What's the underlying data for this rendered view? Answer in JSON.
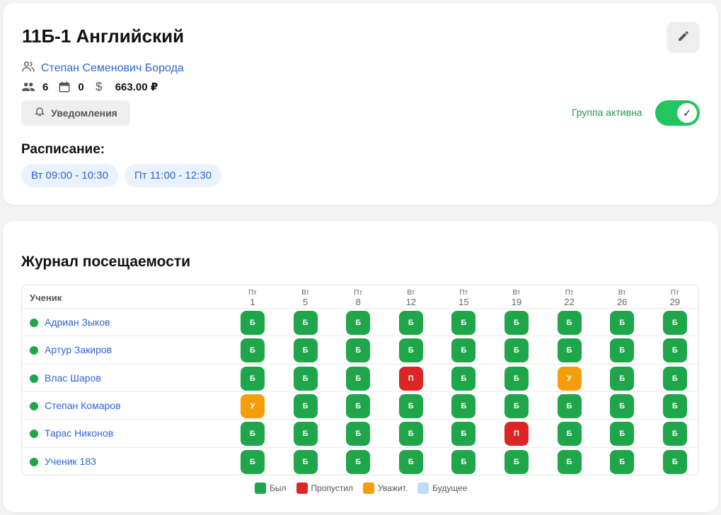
{
  "group": {
    "title": "11Б-1 Английский",
    "teacher": "Степан Семенович Борода",
    "stats": {
      "students": "6",
      "lessons": "0",
      "price": "663.00 ₽"
    },
    "notify_label": "Уведомления",
    "active_label": "Группа активна",
    "active": true,
    "schedule_title": "Расписание:",
    "schedule": [
      "Вт 09:00 - 10:30",
      "Пт 11:00 - 12:30"
    ]
  },
  "journal": {
    "title": "Журнал посещаемости",
    "student_header": "Ученик",
    "dates": [
      {
        "dow": "Пт",
        "day": "1"
      },
      {
        "dow": "Вт",
        "day": "5"
      },
      {
        "dow": "Пт",
        "day": "8"
      },
      {
        "dow": "Вт",
        "day": "12"
      },
      {
        "dow": "Пт",
        "day": "15"
      },
      {
        "dow": "Вт",
        "day": "19"
      },
      {
        "dow": "Пт",
        "day": "22"
      },
      {
        "dow": "Вт",
        "day": "26"
      },
      {
        "dow": "Пт",
        "day": "29"
      }
    ],
    "students": [
      {
        "name": "Адриан Зыков",
        "marks": [
          "Б",
          "Б",
          "Б",
          "Б",
          "Б",
          "Б",
          "Б",
          "Б",
          "Б"
        ]
      },
      {
        "name": "Артур Закиров",
        "marks": [
          "Б",
          "Б",
          "Б",
          "Б",
          "Б",
          "Б",
          "Б",
          "Б",
          "Б"
        ]
      },
      {
        "name": "Влас Шаров",
        "marks": [
          "Б",
          "Б",
          "Б",
          "П",
          "Б",
          "Б",
          "У",
          "Б",
          "Б"
        ]
      },
      {
        "name": "Степан Комаров",
        "marks": [
          "У",
          "Б",
          "Б",
          "Б",
          "Б",
          "Б",
          "Б",
          "Б",
          "Б"
        ]
      },
      {
        "name": "Тарас Никонов",
        "marks": [
          "Б",
          "Б",
          "Б",
          "Б",
          "Б",
          "П",
          "Б",
          "Б",
          "Б"
        ]
      },
      {
        "name": "Ученик 183",
        "marks": [
          "Б",
          "Б",
          "Б",
          "Б",
          "Б",
          "Б",
          "Б",
          "Б",
          "Б"
        ]
      }
    ],
    "mark_colors": {
      "Б": "#1fa64a",
      "П": "#dc2626",
      "У": "#f59e0b"
    },
    "legend": [
      {
        "label": "Был",
        "color": "#1fa64a"
      },
      {
        "label": "Пропустил",
        "color": "#dc2626"
      },
      {
        "label": "Уважит.",
        "color": "#f59e0b"
      },
      {
        "label": "Будущее",
        "color": "#bfdbfe"
      }
    ]
  },
  "icons": {
    "edit": "pencil-icon",
    "teacher": "users-icon",
    "students": "people-icon",
    "calendar": "calendar-icon",
    "price": "dollar-icon",
    "bell": "bell-icon",
    "check": "check-icon"
  }
}
